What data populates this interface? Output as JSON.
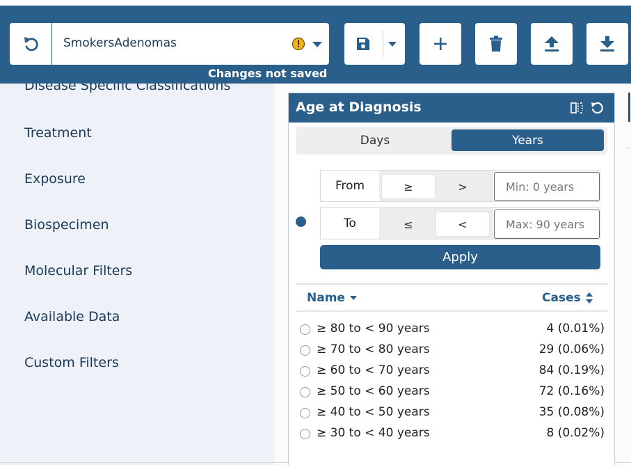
{
  "toolbar": {
    "cohort_name": "SmokersAdenomas",
    "status_text": "Changes not saved",
    "icons": {
      "undo": "undo-icon",
      "warning": "warning-icon",
      "dropdown": "caret-down-icon",
      "save": "floppy-disk-icon",
      "add": "plus-icon",
      "delete": "trash-icon",
      "upload": "upload-icon",
      "download": "download-icon"
    },
    "warning_color": "#f2b21b"
  },
  "sidebar": {
    "items": [
      {
        "label": "Disease Specific Classifications"
      },
      {
        "label": "Treatment"
      },
      {
        "label": "Exposure"
      },
      {
        "label": "Biospecimen"
      },
      {
        "label": "Molecular Filters"
      },
      {
        "label": "Available Data"
      },
      {
        "label": "Custom Filters"
      }
    ]
  },
  "card": {
    "title": "Age at Diagnosis",
    "icons": {
      "flip": "flip-icon",
      "reset": "reset-icon"
    },
    "units": [
      {
        "label": "Days",
        "selected": false
      },
      {
        "label": "Years",
        "selected": true
      }
    ],
    "range": {
      "from": {
        "label": "From",
        "op_inclusive": "≥",
        "op_exclusive": ">",
        "selected": "≥",
        "placeholder": "Min: 0 years"
      },
      "to": {
        "label": "To",
        "op_inclusive": "≤",
        "op_exclusive": "<",
        "selected": "<",
        "placeholder": "Max: 90 years"
      },
      "apply_label": "Apply"
    },
    "table": {
      "name_header": "Name",
      "cases_header": "Cases",
      "rows": [
        {
          "name": "≥ 80 to < 90 years",
          "cases": "4 (0.01%)"
        },
        {
          "name": "≥ 70 to < 80 years",
          "cases": "29 (0.06%)"
        },
        {
          "name": "≥ 60 to < 70 years",
          "cases": "84 (0.19%)"
        },
        {
          "name": "≥ 50 to < 60 years",
          "cases": "72 (0.16%)"
        },
        {
          "name": "≥ 40 to < 50 years",
          "cases": "35 (0.08%)"
        },
        {
          "name": "≥ 30 to < 40 years",
          "cases": "8 (0.02%)"
        }
      ]
    }
  },
  "colors": {
    "brand": "#2a5f8c",
    "sidebar_bg": "#eef1f7",
    "sidebar_text": "#1b3a57"
  }
}
